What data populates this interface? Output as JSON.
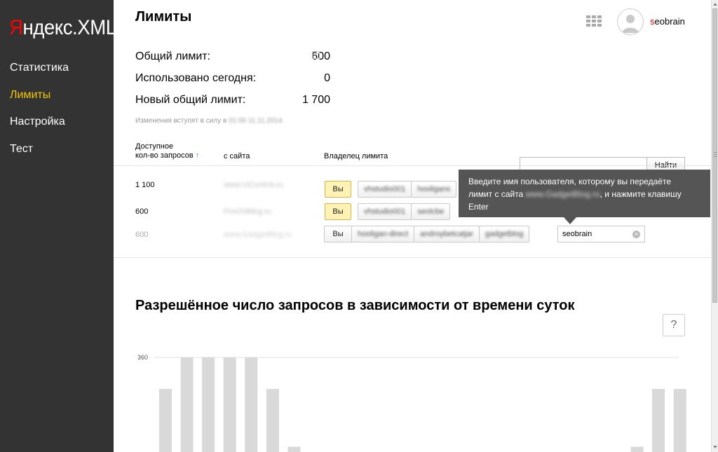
{
  "brand": {
    "logo_y": "Я",
    "logo_rest": "ндекс.XML"
  },
  "sidebar": {
    "items": [
      {
        "label": "Статистика",
        "active": false
      },
      {
        "label": "Лимиты",
        "active": true
      },
      {
        "label": "Настройка",
        "active": false
      },
      {
        "label": "Тест",
        "active": false
      }
    ]
  },
  "header": {
    "title": "Лимиты",
    "user_first": "s",
    "user_rest": "eobrain"
  },
  "limits": {
    "total_label": "Общий лимит:",
    "total_value": "600",
    "used_label": "Использовано сегодня:",
    "used_value": "0",
    "new_label": "Новый общий лимит:",
    "new_value": "1 700",
    "note_prefix": "Изменения вступят в силу в ",
    "note_blurred": "01:00 11.11.2014.",
    "help_icon": "?"
  },
  "table": {
    "col_available_1": "Доступное",
    "col_available_2": "кол-во запросов",
    "sort_icon": "↑",
    "col_site": "с сайта",
    "col_owner": "Владелец лимита",
    "find_button": "Найти",
    "rows": [
      {
        "count": "1 100",
        "site": "www.UiControl.ru",
        "you_label": "Вы",
        "owners": [
          "vhstudio001",
          "hooligans"
        ],
        "muted": false
      },
      {
        "count": "600",
        "site": "ProOnlblog.ru",
        "you_label": "Вы",
        "owners": [
          "vhstudio001",
          "seolcbe"
        ],
        "muted": false
      },
      {
        "count": "600",
        "site": "www.GadgetBlog.ru",
        "you_label": "Вы",
        "owners": [
          "hooligan-direct",
          "androybetcatjar",
          "gadgetblog"
        ],
        "muted": true,
        "input_value": "seobrain",
        "clear_icon": "×"
      }
    ]
  },
  "tooltip": {
    "line1": "Введите имя пользователя, которому вы передаёте",
    "line2_prefix": "лимит с сайта ",
    "line2_blurred": "www.GadgetBlog.ru",
    "line2_suffix": ", и нажмите клавишу",
    "line3": "Enter"
  },
  "chart_section": {
    "title": "Разрешённое число запросов в зависимости от времени суток",
    "help_icon": "?"
  },
  "chart_data": {
    "type": "bar",
    "title": "Разрешённое число запросов в зависимости от времени суток",
    "y_tick_labels": [
      "360"
    ],
    "ylim": [
      0,
      360
    ],
    "values": [
      240,
      360,
      360,
      360,
      360,
      240,
      20,
      0,
      0,
      0,
      0,
      0,
      0,
      0,
      0,
      0,
      0,
      0,
      0,
      0,
      0,
      0,
      20,
      240,
      240
    ],
    "bar_color": "#d9d9d9",
    "grid": true
  },
  "colors": {
    "sidebar_bg": "#333333",
    "active_nav": "#f7c700",
    "logo_red": "#ff0000",
    "tooltip_bg": "#555555",
    "selected_btn": "#fff2b5"
  }
}
